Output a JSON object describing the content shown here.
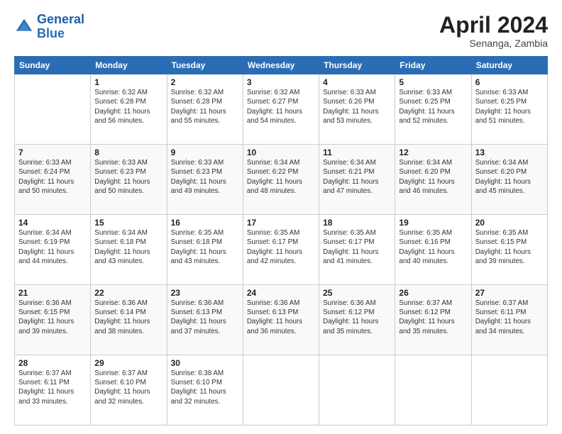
{
  "header": {
    "logo_general": "General",
    "logo_blue": "Blue",
    "month": "April 2024",
    "location": "Senanga, Zambia"
  },
  "weekdays": [
    "Sunday",
    "Monday",
    "Tuesday",
    "Wednesday",
    "Thursday",
    "Friday",
    "Saturday"
  ],
  "weeks": [
    [
      {
        "day": "",
        "info": ""
      },
      {
        "day": "1",
        "info": "Sunrise: 6:32 AM\nSunset: 6:28 PM\nDaylight: 11 hours\nand 56 minutes."
      },
      {
        "day": "2",
        "info": "Sunrise: 6:32 AM\nSunset: 6:28 PM\nDaylight: 11 hours\nand 55 minutes."
      },
      {
        "day": "3",
        "info": "Sunrise: 6:32 AM\nSunset: 6:27 PM\nDaylight: 11 hours\nand 54 minutes."
      },
      {
        "day": "4",
        "info": "Sunrise: 6:33 AM\nSunset: 6:26 PM\nDaylight: 11 hours\nand 53 minutes."
      },
      {
        "day": "5",
        "info": "Sunrise: 6:33 AM\nSunset: 6:25 PM\nDaylight: 11 hours\nand 52 minutes."
      },
      {
        "day": "6",
        "info": "Sunrise: 6:33 AM\nSunset: 6:25 PM\nDaylight: 11 hours\nand 51 minutes."
      }
    ],
    [
      {
        "day": "7",
        "info": "Sunrise: 6:33 AM\nSunset: 6:24 PM\nDaylight: 11 hours\nand 50 minutes."
      },
      {
        "day": "8",
        "info": "Sunrise: 6:33 AM\nSunset: 6:23 PM\nDaylight: 11 hours\nand 50 minutes."
      },
      {
        "day": "9",
        "info": "Sunrise: 6:33 AM\nSunset: 6:23 PM\nDaylight: 11 hours\nand 49 minutes."
      },
      {
        "day": "10",
        "info": "Sunrise: 6:34 AM\nSunset: 6:22 PM\nDaylight: 11 hours\nand 48 minutes."
      },
      {
        "day": "11",
        "info": "Sunrise: 6:34 AM\nSunset: 6:21 PM\nDaylight: 11 hours\nand 47 minutes."
      },
      {
        "day": "12",
        "info": "Sunrise: 6:34 AM\nSunset: 6:20 PM\nDaylight: 11 hours\nand 46 minutes."
      },
      {
        "day": "13",
        "info": "Sunrise: 6:34 AM\nSunset: 6:20 PM\nDaylight: 11 hours\nand 45 minutes."
      }
    ],
    [
      {
        "day": "14",
        "info": "Sunrise: 6:34 AM\nSunset: 6:19 PM\nDaylight: 11 hours\nand 44 minutes."
      },
      {
        "day": "15",
        "info": "Sunrise: 6:34 AM\nSunset: 6:18 PM\nDaylight: 11 hours\nand 43 minutes."
      },
      {
        "day": "16",
        "info": "Sunrise: 6:35 AM\nSunset: 6:18 PM\nDaylight: 11 hours\nand 43 minutes."
      },
      {
        "day": "17",
        "info": "Sunrise: 6:35 AM\nSunset: 6:17 PM\nDaylight: 11 hours\nand 42 minutes."
      },
      {
        "day": "18",
        "info": "Sunrise: 6:35 AM\nSunset: 6:17 PM\nDaylight: 11 hours\nand 41 minutes."
      },
      {
        "day": "19",
        "info": "Sunrise: 6:35 AM\nSunset: 6:16 PM\nDaylight: 11 hours\nand 40 minutes."
      },
      {
        "day": "20",
        "info": "Sunrise: 6:35 AM\nSunset: 6:15 PM\nDaylight: 11 hours\nand 39 minutes."
      }
    ],
    [
      {
        "day": "21",
        "info": "Sunrise: 6:36 AM\nSunset: 6:15 PM\nDaylight: 11 hours\nand 39 minutes."
      },
      {
        "day": "22",
        "info": "Sunrise: 6:36 AM\nSunset: 6:14 PM\nDaylight: 11 hours\nand 38 minutes."
      },
      {
        "day": "23",
        "info": "Sunrise: 6:36 AM\nSunset: 6:13 PM\nDaylight: 11 hours\nand 37 minutes."
      },
      {
        "day": "24",
        "info": "Sunrise: 6:36 AM\nSunset: 6:13 PM\nDaylight: 11 hours\nand 36 minutes."
      },
      {
        "day": "25",
        "info": "Sunrise: 6:36 AM\nSunset: 6:12 PM\nDaylight: 11 hours\nand 35 minutes."
      },
      {
        "day": "26",
        "info": "Sunrise: 6:37 AM\nSunset: 6:12 PM\nDaylight: 11 hours\nand 35 minutes."
      },
      {
        "day": "27",
        "info": "Sunrise: 6:37 AM\nSunset: 6:11 PM\nDaylight: 11 hours\nand 34 minutes."
      }
    ],
    [
      {
        "day": "28",
        "info": "Sunrise: 6:37 AM\nSunset: 6:11 PM\nDaylight: 11 hours\nand 33 minutes."
      },
      {
        "day": "29",
        "info": "Sunrise: 6:37 AM\nSunset: 6:10 PM\nDaylight: 11 hours\nand 32 minutes."
      },
      {
        "day": "30",
        "info": "Sunrise: 6:38 AM\nSunset: 6:10 PM\nDaylight: 11 hours\nand 32 minutes."
      },
      {
        "day": "",
        "info": ""
      },
      {
        "day": "",
        "info": ""
      },
      {
        "day": "",
        "info": ""
      },
      {
        "day": "",
        "info": ""
      }
    ]
  ]
}
